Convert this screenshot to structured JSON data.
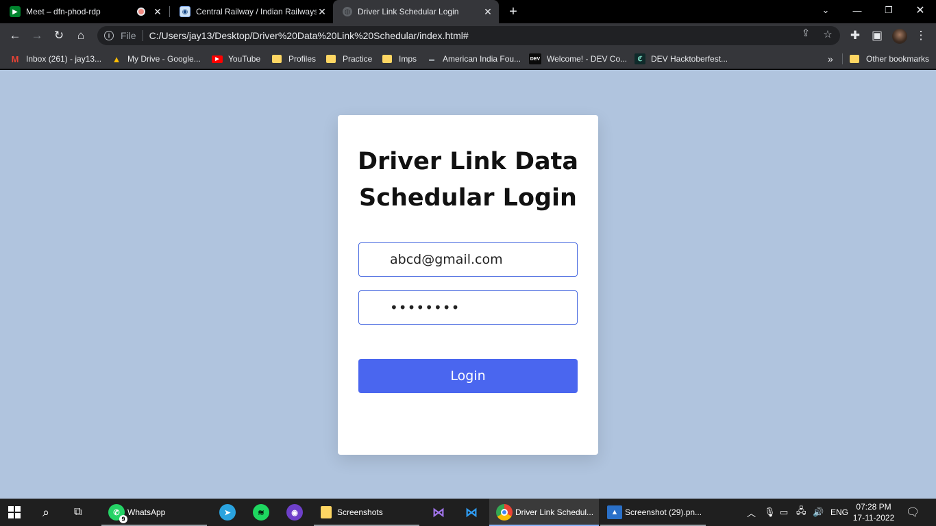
{
  "tabs": [
    {
      "title": "Meet – dfn-phod-rdp",
      "icon": "meet-icon"
    },
    {
      "title": "Central Railway / Indian Railways",
      "icon": "railway-icon"
    },
    {
      "title": "Driver Link Schedular Login",
      "icon": "globe-icon"
    }
  ],
  "toolbar": {
    "scheme": "File",
    "url": "C:/Users/jay13/Desktop/Driver%20Data%20Link%20Schedular/index.html#"
  },
  "bookmarks": [
    {
      "label": "Inbox (261) - jay13...",
      "icon": "gmail-icon"
    },
    {
      "label": "My Drive - Google...",
      "icon": "drive-icon"
    },
    {
      "label": "YouTube",
      "icon": "youtube-icon"
    },
    {
      "label": "Profiles",
      "icon": "folder-icon"
    },
    {
      "label": "Practice",
      "icon": "folder-icon"
    },
    {
      "label": "Imps",
      "icon": "folder-icon"
    },
    {
      "label": "American India Fou...",
      "icon": "aif-icon"
    },
    {
      "label": "Welcome! - DEV Co...",
      "icon": "dev-icon"
    },
    {
      "label": "DEV Hacktoberfest...",
      "icon": "hacktoberfest-icon"
    },
    {
      "label": "Other bookmarks",
      "icon": "folder-icon"
    }
  ],
  "bookmarks_overflow": "»",
  "login": {
    "title_line1": "Driver Link Data",
    "title_line2": "Schedular Login",
    "email_value": "abcd@gmail.com",
    "password_mask": "••••••••",
    "login_label": "Login"
  },
  "taskbar": {
    "whatsapp_label": "WhatsApp",
    "whatsapp_badge": "9",
    "screenshots_label": "Screenshots",
    "chrome_label": "Driver Link Schedul...",
    "photos_label": "Screenshot (29).pn...",
    "lang": "ENG",
    "time": "07:28 PM",
    "date": "17-11-2022"
  },
  "colors": {
    "page_bg": "#b0c4de",
    "button": "#4a66ef",
    "field_border": "#4a6be0"
  }
}
